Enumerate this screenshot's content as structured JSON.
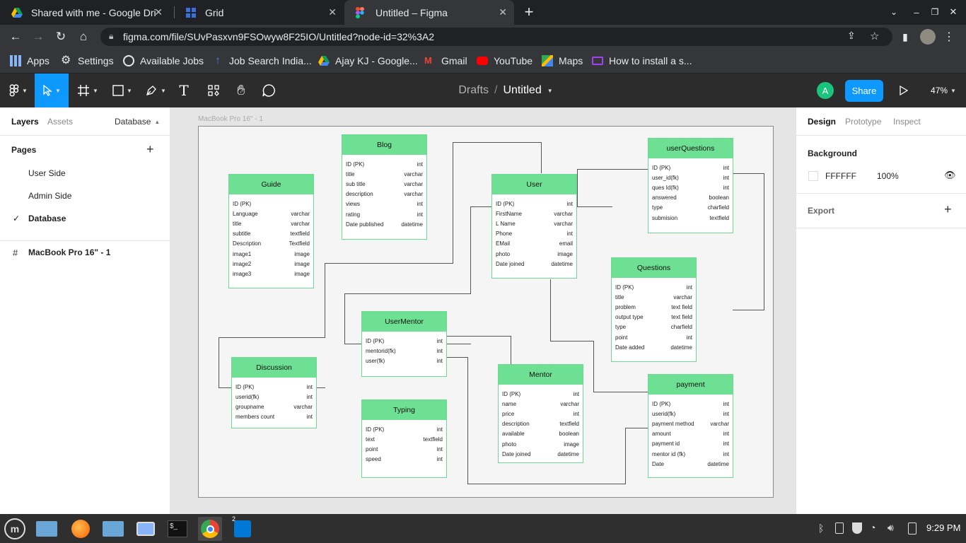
{
  "browser": {
    "tabs": [
      {
        "title": "Shared with me - Google Drive"
      },
      {
        "title": "Grid"
      },
      {
        "title": "Untitled – Figma"
      }
    ],
    "url": "figma.com/file/SUvPasxvn9FSOwyw8F25IO/Untitled?node-id=32%3A2",
    "bookmarks": [
      "Apps",
      "Settings",
      "Available Jobs",
      "Job Search India...",
      "Ajay KJ - Google...",
      "Gmail",
      "YouTube",
      "Maps",
      "How to install a s..."
    ]
  },
  "figma": {
    "breadcrumb_parent": "Drafts",
    "breadcrumb_sep": "/",
    "file_name": "Untitled",
    "avatar_letter": "A",
    "share_label": "Share",
    "zoom": "47%"
  },
  "left_panel": {
    "tabs": {
      "layers": "Layers",
      "assets": "Assets",
      "page_select": "Database"
    },
    "pages_heading": "Pages",
    "pages": [
      "User Side",
      "Admin Side",
      "Database"
    ],
    "current_page_check": "✓",
    "layer": "MacBook Pro 16\" - 1",
    "layer_icon": "#"
  },
  "right_panel": {
    "tabs": {
      "design": "Design",
      "prototype": "Prototype",
      "inspect": "Inspect"
    },
    "background_label": "Background",
    "bg_hex": "FFFFFF",
    "bg_opacity": "100%",
    "export_label": "Export"
  },
  "canvas": {
    "frame_label": "MacBook Pro 16\" - 1",
    "tables": {
      "blog": {
        "name": "Blog",
        "rows": [
          [
            "ID (PK)",
            "int"
          ],
          [
            "title",
            "varchar"
          ],
          [
            "sub title",
            "varchar"
          ],
          [
            "description",
            "varchar"
          ],
          [
            "views",
            "int"
          ],
          [
            "rating",
            "int"
          ],
          [
            "Date published",
            "datetime"
          ]
        ]
      },
      "guide": {
        "name": "Guide",
        "rows": [
          [
            "ID (PK)",
            ""
          ],
          [
            "Language",
            "varchar"
          ],
          [
            "title",
            "varchar"
          ],
          [
            "subtitle",
            "textfield"
          ],
          [
            "Description",
            "Textfield"
          ],
          [
            "image1",
            "image"
          ],
          [
            "image2",
            "image"
          ],
          [
            "image3",
            "image"
          ]
        ]
      },
      "user": {
        "name": "User",
        "rows": [
          [
            "ID (PK)",
            "int"
          ],
          [
            "FirstName",
            "varchar"
          ],
          [
            "L  Name",
            "varchar"
          ],
          [
            "Phone",
            "int"
          ],
          [
            "EMail",
            "email"
          ],
          [
            "photo",
            "image"
          ],
          [
            "Date joined",
            "datetime"
          ]
        ]
      },
      "userQuestions": {
        "name": "userQuestions",
        "rows": [
          [
            "ID (PK)",
            "int"
          ],
          [
            "user_id(fk)",
            "int"
          ],
          [
            "ques Id(fk)",
            "int"
          ],
          [
            "answered",
            "boolean"
          ],
          [
            "type",
            "charfield"
          ],
          [
            "submision",
            "textfield"
          ]
        ]
      },
      "questions": {
        "name": "Questions",
        "rows": [
          [
            "ID (PK)",
            "int"
          ],
          [
            "title",
            "varchar"
          ],
          [
            "problem",
            "text field"
          ],
          [
            "output type",
            "text field"
          ],
          [
            "type",
            "charfield"
          ],
          [
            "point",
            "int"
          ],
          [
            "Date  added",
            "datetime"
          ]
        ]
      },
      "userMentor": {
        "name": "UserMentor",
        "rows": [
          [
            "ID (PK)",
            "int"
          ],
          [
            "mentorid(fk)",
            "int"
          ],
          [
            "user(fk)",
            "int"
          ]
        ]
      },
      "discussion": {
        "name": "Discussion",
        "rows": [
          [
            "ID (PK)",
            "int"
          ],
          [
            "userid(fk)",
            "int"
          ],
          [
            "groupname",
            "varchar"
          ],
          [
            "members count",
            "int"
          ]
        ]
      },
      "mentor": {
        "name": "Mentor",
        "rows": [
          [
            "ID (PK)",
            "int"
          ],
          [
            "name",
            "varchar"
          ],
          [
            "price",
            "int"
          ],
          [
            "description",
            "textfield"
          ],
          [
            "available",
            "boolean"
          ],
          [
            "photo",
            "image"
          ],
          [
            "Date joined",
            "datetime"
          ]
        ]
      },
      "typing": {
        "name": "Typing",
        "rows": [
          [
            "ID (PK)",
            "int"
          ],
          [
            "text",
            "textfield"
          ],
          [
            "point",
            "int"
          ],
          [
            "speed",
            "int"
          ]
        ]
      },
      "payment": {
        "name": "payment",
        "rows": [
          [
            "ID (PK)",
            "int"
          ],
          [
            "userid(fk)",
            "int"
          ],
          [
            "payment method",
            "varchar"
          ],
          [
            "amount",
            "int"
          ],
          [
            "payment id",
            "int"
          ],
          [
            "mentor id (fk)",
            "int"
          ],
          [
            "Date",
            "datetime"
          ]
        ]
      }
    },
    "help_label": "?"
  },
  "taskbar": {
    "clock": "9:29 PM",
    "vscode_badge": "2"
  }
}
